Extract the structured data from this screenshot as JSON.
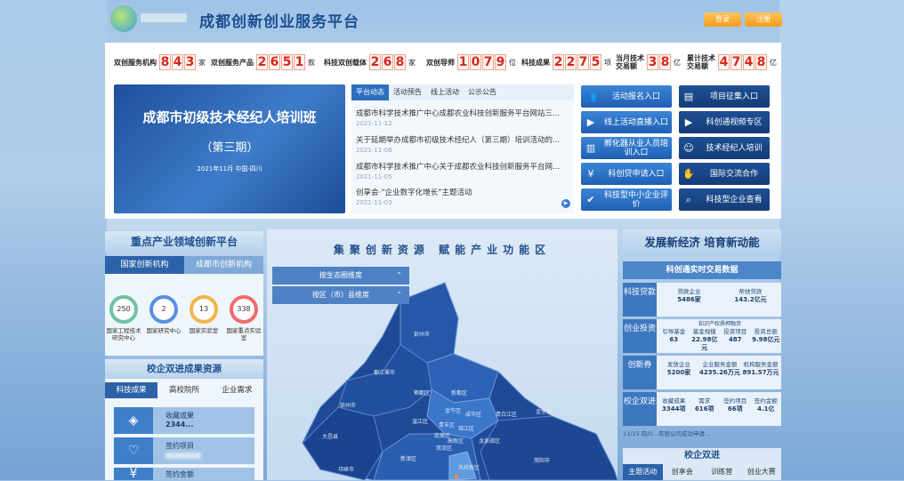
{
  "header": {
    "title": "成都创新创业服务平台",
    "login": "登录",
    "register": "注册"
  },
  "stats": [
    {
      "label": "双创服务机构",
      "digits": [
        "8",
        "4",
        "3"
      ],
      "unit": "家"
    },
    {
      "label": "双创服务产品",
      "digits": [
        "2",
        "6",
        "5",
        "1"
      ],
      "unit": "款"
    },
    {
      "label": "科技双创载体",
      "digits": [
        "2",
        "6",
        "8"
      ],
      "unit": "家"
    },
    {
      "label": "双创导师",
      "digits": [
        "1",
        "0",
        "7",
        "9"
      ],
      "unit": "位"
    },
    {
      "label": "科技成果",
      "digits": [
        "2",
        "2",
        "7",
        "5"
      ],
      "unit": "项"
    },
    {
      "label_1": "当月技术",
      "label_2": "交易额",
      "digits": [
        "3",
        "8"
      ],
      "unit": "亿"
    },
    {
      "label_1": "累计技术",
      "label_2": "交易额",
      "digits": [
        "4",
        "7",
        "4",
        "8"
      ],
      "unit": "亿"
    }
  ],
  "banner": {
    "title": "成都市初级技术经纪人培训班",
    "subtitle": "（第三期）",
    "date": "2021年11月 中国·四川"
  },
  "news": {
    "tabs": [
      "平台动态",
      "活动预告",
      "线上活动",
      "公示公告"
    ],
    "items": [
      {
        "text": "成都市科学技术推广中心成都农业科技创新服务平台网站三...",
        "date": "2021-11-12"
      },
      {
        "text": "关于延期举办成都市初级技术经纪人（第三期）培训活动的...",
        "date": "2021-11-08"
      },
      {
        "text": "成都市科学技术推广中心关于成都农业科技创新服务平台网...",
        "date": "2021-11-05"
      },
      {
        "text": "创享会·“企业数字化增长”主题活动",
        "date": "2021-11-03"
      }
    ]
  },
  "quick_links": [
    {
      "label": "活动报名入口",
      "icon": "people-icon"
    },
    {
      "label": "项目征集入口",
      "icon": "folder-icon"
    },
    {
      "label": "线上活动直播入口",
      "icon": "play-icon"
    },
    {
      "label": "科创通视频专区",
      "icon": "video-icon"
    },
    {
      "label": "孵化器从业人员培训入口",
      "icon": "book-icon"
    },
    {
      "label": "技术经纪人培训",
      "icon": "person-icon"
    },
    {
      "label": "科创贷申请入口",
      "icon": "money-icon"
    },
    {
      "label": "国际交流合作",
      "icon": "handshake-icon"
    },
    {
      "label": "科技型中小企业评价",
      "icon": "check-icon"
    },
    {
      "label": "科技型企业查看",
      "icon": "search-icon"
    }
  ],
  "left": {
    "section_title": "重点产业领域创新平台",
    "tabs": [
      "国家创新机构",
      "成都市创新机构"
    ],
    "rings": [
      {
        "value": "250",
        "label": "国家工程技术研究中心",
        "color": "#6ec3a0"
      },
      {
        "value": "2",
        "label": "国家研究中心",
        "color": "#5c8fe0"
      },
      {
        "value": "13",
        "label": "国家实验室",
        "color": "#f0b64a"
      },
      {
        "value": "338",
        "label": "国家重点实验室",
        "color": "#f26b6b"
      }
    ],
    "resource_title": "校企双进成果资源",
    "resource_tabs": [
      "科技成果",
      "高校院所",
      "企业需求"
    ],
    "resource_items": [
      {
        "label": "收藏成果",
        "value": "2344..."
      },
      {
        "label": "签约项目"
      },
      {
        "label": "签约金额"
      }
    ]
  },
  "center": {
    "title": "集聚创新资源 赋能产业功能区",
    "controls": [
      "按生态圈维度",
      "按区（市）县维度"
    ],
    "districts": [
      "彭州市",
      "都江堰市",
      "郫都区",
      "新都区",
      "青白江区",
      "金堂县",
      "崇州市",
      "温江区",
      "金牛区",
      "成华区",
      "青羊区",
      "锦江区",
      "武侯区",
      "大邑县",
      "双流区",
      "新津区",
      "邛崃市",
      "龙泉驿区",
      "简阳市",
      "高新区",
      "天府新区"
    ]
  },
  "right": {
    "title": "发展新经济 培育新动能",
    "subtitle": "科创通实时交易数据",
    "rows": [
      {
        "tag": "科技贷款",
        "cells": [
          {
            "k": "贷款企业",
            "v": "5486家"
          },
          {
            "k": "帮扶贷款",
            "v": "143.2亿元"
          }
        ]
      },
      {
        "tag": "创业投资",
        "header": "知识产权质押融资",
        "cells": [
          {
            "k": "引导基金",
            "v": "63"
          },
          {
            "k": "基金规模",
            "v": "22.98亿元"
          },
          {
            "k": "投资项目",
            "v": "487"
          },
          {
            "k": "投资总额",
            "v": "9.98亿元"
          }
        ]
      },
      {
        "tag": "创新券",
        "cells": [
          {
            "k": "发放企业",
            "v": "5200家"
          },
          {
            "k": "企业服务金额",
            "v": "4235.26万元"
          },
          {
            "k": "机构服务金额",
            "v": "891.57万元"
          }
        ]
      },
      {
        "tag": "校企双进",
        "cells": [
          {
            "k": "收藏成果",
            "v": "3344项"
          },
          {
            "k": "需求",
            "v": "616项"
          },
          {
            "k": "签约项目",
            "v": "66项"
          },
          {
            "k": "签约金额",
            "v": "4.1亿"
          }
        ]
      }
    ],
    "ticker": "11/15 四川...有限公司成功申请...",
    "bottom_title": "校企双进",
    "bottom_tabs": [
      "主题活动",
      "创享会",
      "训练营",
      "创业大赛"
    ]
  }
}
